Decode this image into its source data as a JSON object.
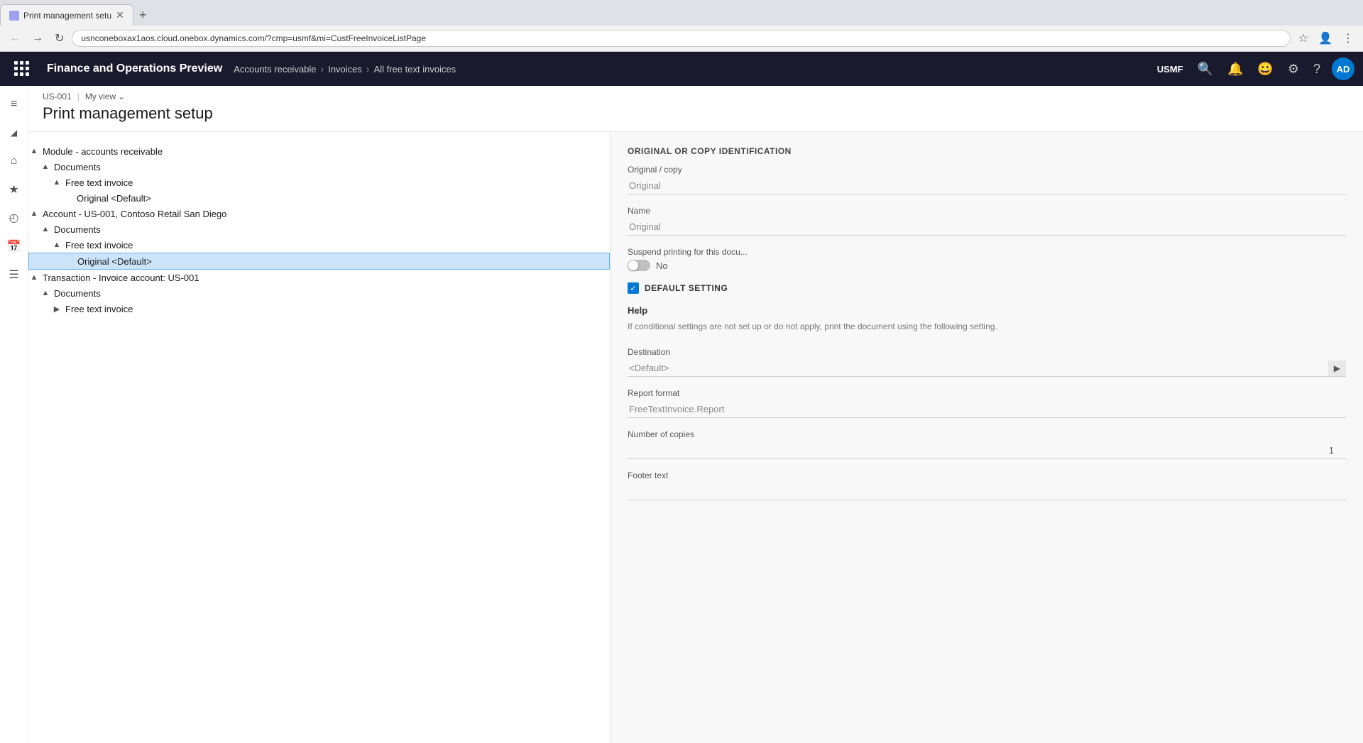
{
  "browser": {
    "tab_title": "Print management setu",
    "tab_favicon": "🔵",
    "new_tab_label": "+",
    "address_bar_url": "usnconeboxax1aos.cloud.onebox.dynamics.com/?cmp=usmf&mi=CustFreeInvoiceListPage",
    "nav_back_title": "Back",
    "nav_forward_title": "Forward",
    "nav_refresh_title": "Refresh"
  },
  "top_nav": {
    "app_title": "Finance and Operations Preview",
    "breadcrumb": [
      {
        "label": "Accounts receivable"
      },
      {
        "label": "Invoices"
      },
      {
        "label": "All free text invoices"
      }
    ],
    "company": "USMF",
    "avatar_initials": "AD"
  },
  "sidebar_icons": {
    "menu_icon": "≡",
    "filter_icon": "▼",
    "home_icon": "⌂",
    "star_icon": "☆",
    "recent_icon": "◷",
    "calendar_icon": "▦",
    "list_icon": "≣"
  },
  "page_header": {
    "company_code": "US-001",
    "view_label": "My view",
    "page_title": "Print management setup"
  },
  "tree": {
    "nodes": [
      {
        "id": "module",
        "indent": 0,
        "toggle": "▲",
        "label": "Module - accounts receivable",
        "selected": false
      },
      {
        "id": "documents1",
        "indent": 1,
        "toggle": "▲",
        "label": "Documents",
        "selected": false
      },
      {
        "id": "fti1",
        "indent": 2,
        "toggle": "▲",
        "label": "Free text invoice",
        "selected": false
      },
      {
        "id": "original_default1",
        "indent": 3,
        "toggle": "",
        "label": "Original <Default>",
        "selected": false
      },
      {
        "id": "account",
        "indent": 0,
        "toggle": "▲",
        "label": "Account - US-001, Contoso Retail San Diego",
        "selected": false
      },
      {
        "id": "documents2",
        "indent": 1,
        "toggle": "▲",
        "label": "Documents",
        "selected": false
      },
      {
        "id": "fti2",
        "indent": 2,
        "toggle": "▲",
        "label": "Free text invoice",
        "selected": false
      },
      {
        "id": "original_default2",
        "indent": 3,
        "toggle": "",
        "label": "Original <Default>",
        "selected": true
      },
      {
        "id": "transaction",
        "indent": 0,
        "toggle": "▲",
        "label": "Transaction - Invoice account: US-001",
        "selected": false
      },
      {
        "id": "documents3",
        "indent": 1,
        "toggle": "▲",
        "label": "Documents",
        "selected": false
      },
      {
        "id": "fti3",
        "indent": 2,
        "toggle": "▶",
        "label": "Free text invoice",
        "selected": false
      }
    ]
  },
  "detail": {
    "section_title": "ORIGINAL OR COPY IDENTIFICATION",
    "original_copy_label": "Original / copy",
    "original_copy_value": "Original",
    "name_label": "Name",
    "name_value": "Original",
    "suspend_print_label": "Suspend printing for this docu...",
    "suspend_print_toggle": "No",
    "default_setting_title": "DEFAULT SETTING",
    "help_title": "Help",
    "help_text": "If conditional settings are not set up or do not apply, print the document using the following setting.",
    "destination_label": "Destination",
    "destination_value": "<Default>",
    "destination_btn": "▶",
    "report_format_label": "Report format",
    "report_format_value": "FreeTextInvoice.Report",
    "copies_label": "Number of copies",
    "copies_value": "1",
    "footer_text_label": "Footer text"
  }
}
